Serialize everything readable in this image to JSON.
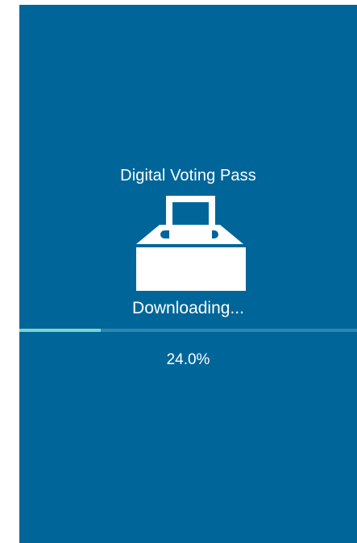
{
  "app": {
    "title": "Digital Voting Pass",
    "icon": "ballot-box-icon"
  },
  "download": {
    "status": "Downloading...",
    "progress_fraction": 0.24,
    "progress_text": "24.0%"
  },
  "colors": {
    "background": "#006699",
    "progress_fill": "#7fd0cc",
    "progress_track": "#2f86b2",
    "text": "#ffffff"
  }
}
